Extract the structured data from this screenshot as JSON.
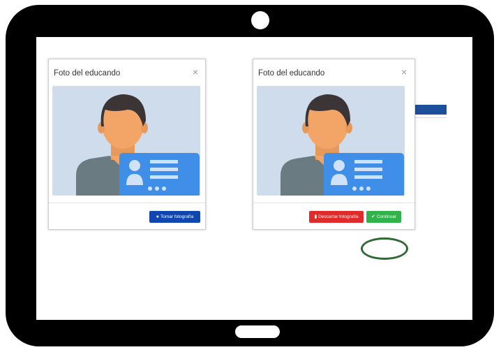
{
  "left_modal": {
    "title": "Foto del educando",
    "close_symbol": "×",
    "take_photo_label": "Tomar fotografía",
    "take_photo_icon": "camera-icon",
    "button_color": "#1046b0"
  },
  "right_modal": {
    "title": "Foto del educando",
    "close_symbol": "×",
    "discard_label": "Descartar fotografía",
    "discard_icon": "trash-icon",
    "discard_color": "#e02b2b",
    "continue_label": "Continuar",
    "continue_icon": "check-icon",
    "continue_color": "#2fb34a"
  },
  "colors": {
    "tablet_frame": "#000000",
    "photo_background": "#cfdcec",
    "highlight_ring": "#2f6a35"
  }
}
